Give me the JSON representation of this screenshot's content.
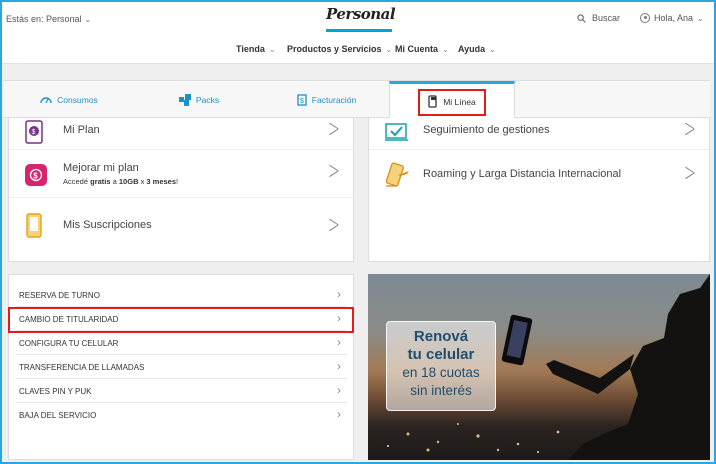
{
  "header": {
    "location_label": "Estás en: Personal",
    "logo_text": "Personal",
    "search_label": "Buscar",
    "user_greeting": "Hola, Ana"
  },
  "nav": {
    "items": [
      {
        "label": "Tienda"
      },
      {
        "label": "Productos y Servicios"
      },
      {
        "label": "Mi Cuenta"
      },
      {
        "label": "Ayuda"
      }
    ]
  },
  "tabs": [
    {
      "label": "Consumos",
      "icon": "gauge-icon"
    },
    {
      "label": "Packs",
      "icon": "packs-icon"
    },
    {
      "label": "Facturación",
      "icon": "invoice-icon"
    },
    {
      "label": "Mi Línea",
      "icon": "phone-line-icon",
      "active": true
    }
  ],
  "left_card": {
    "items": [
      {
        "title": "Mi Plan",
        "icon": "plan-icon"
      },
      {
        "title": "Mejorar mi plan",
        "sub_pre": "Accedé ",
        "sub_bold1": "gratis",
        "sub_mid": " a ",
        "sub_bold2": "10GB",
        "sub_mid2": " x ",
        "sub_bold3": "3 meses",
        "sub_end": "!",
        "icon": "upgrade-icon"
      },
      {
        "title": "Mis Suscripciones",
        "icon": "subscriptions-icon"
      }
    ]
  },
  "right_card": {
    "items": [
      {
        "title": "Seguimiento de gestiones",
        "icon": "tracking-icon"
      },
      {
        "title": "Roaming y Larga Distancia Internacional",
        "icon": "roaming-icon"
      }
    ]
  },
  "services_list": [
    "RESERVA DE TURNO",
    "CAMBIO DE TITULARIDAD",
    "CONFIGURA TU CELULAR",
    "TRANSFERENCIA DE LLAMADAS",
    "CLAVES PIN Y PUK",
    "BAJA DEL SERVICIO"
  ],
  "promo": {
    "line1": "Renová",
    "line2": "tu celular",
    "line3": "en 18 cuotas",
    "line4": "sin interés"
  },
  "colors": {
    "accent": "#2aa7e0",
    "highlight": "#e21b1b",
    "plan_icon": "#7b2e8e",
    "upgrade_icon": "#d6246e",
    "subs_icon": "#e5a21b"
  }
}
